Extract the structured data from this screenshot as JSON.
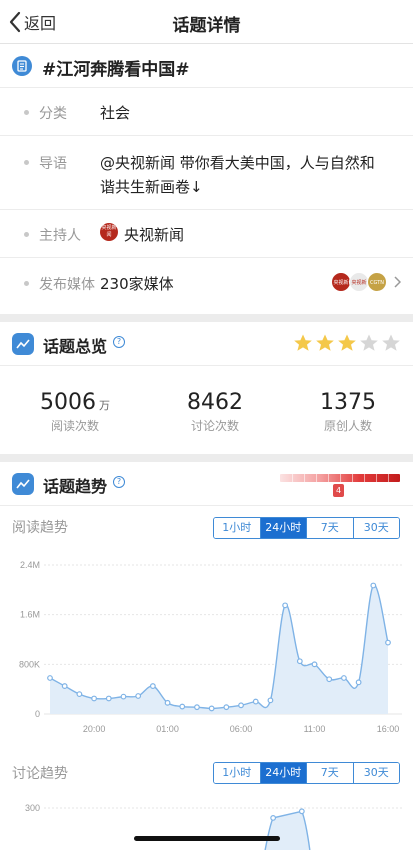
{
  "nav": {
    "back_label": "返回",
    "title": "话题详情"
  },
  "topic": {
    "title": "#江河奔腾看中国#",
    "rows": [
      {
        "label": "分类",
        "value": "社会"
      },
      {
        "label": "导语",
        "value_line1": "@央视新闻 带你看大美中国，人与自然和",
        "value_line2": "谐共生新画卷↓"
      },
      {
        "label": "主持人",
        "value": "央视新闻",
        "avatar_text": "央视新闻"
      },
      {
        "label": "发布媒体",
        "value": "230家媒体"
      }
    ],
    "media_logos": [
      {
        "text": "央视新闻",
        "color": "#b5291d"
      },
      {
        "text": "央视新闻",
        "color": "#e9e9e9"
      },
      {
        "text": "CGTN",
        "color": "#c5a245"
      }
    ]
  },
  "overview": {
    "title": "话题总览",
    "rating": 3,
    "rating_max": 5,
    "stats": [
      {
        "value": "5006",
        "unit": "万",
        "label": "阅读次数"
      },
      {
        "value": "8462",
        "unit": "",
        "label": "讨论次数"
      },
      {
        "value": "1375",
        "unit": "",
        "label": "原创人数"
      }
    ]
  },
  "trend": {
    "title": "话题趋势",
    "heat_level": "4",
    "range_tabs": [
      "1小时",
      "24小时",
      "7天",
      "30天"
    ],
    "selected_tab": "24小时",
    "read_label": "阅读趋势",
    "discuss_label": "讨论趋势"
  },
  "chart_data": [
    {
      "type": "area",
      "title": "阅读趋势",
      "y_tick_labels": [
        "2.4M",
        "1.6M",
        "800K",
        "0"
      ],
      "y_ticks": [
        2400000,
        1600000,
        800000,
        0
      ],
      "ylim": [
        0,
        2400000
      ],
      "x_tick_labels": [
        "20:00",
        "01:00",
        "06:00",
        "11:00",
        "16:00"
      ],
      "x_tick_positions": [
        3,
        8,
        13,
        18,
        23
      ],
      "x": [
        0,
        1,
        2,
        3,
        4,
        5,
        6,
        7,
        8,
        9,
        10,
        11,
        12,
        13,
        14,
        15,
        16,
        17,
        18,
        19,
        20,
        21,
        22,
        23
      ],
      "values": [
        580000,
        450000,
        320000,
        250000,
        250000,
        280000,
        290000,
        450000,
        180000,
        120000,
        110000,
        90000,
        110000,
        140000,
        200000,
        220000,
        1750000,
        850000,
        800000,
        560000,
        580000,
        510000,
        2070000,
        1150000
      ],
      "line_color": "#7fb3e6",
      "fill_color": "#e1edf9",
      "grid": true
    },
    {
      "type": "area",
      "title": "讨论趋势",
      "y_tick_labels": [
        "300"
      ],
      "y_ticks": [
        300
      ],
      "x": [
        16,
        17
      ],
      "values": [
        270,
        290
      ],
      "line_color": "#7fb3e6"
    }
  ]
}
